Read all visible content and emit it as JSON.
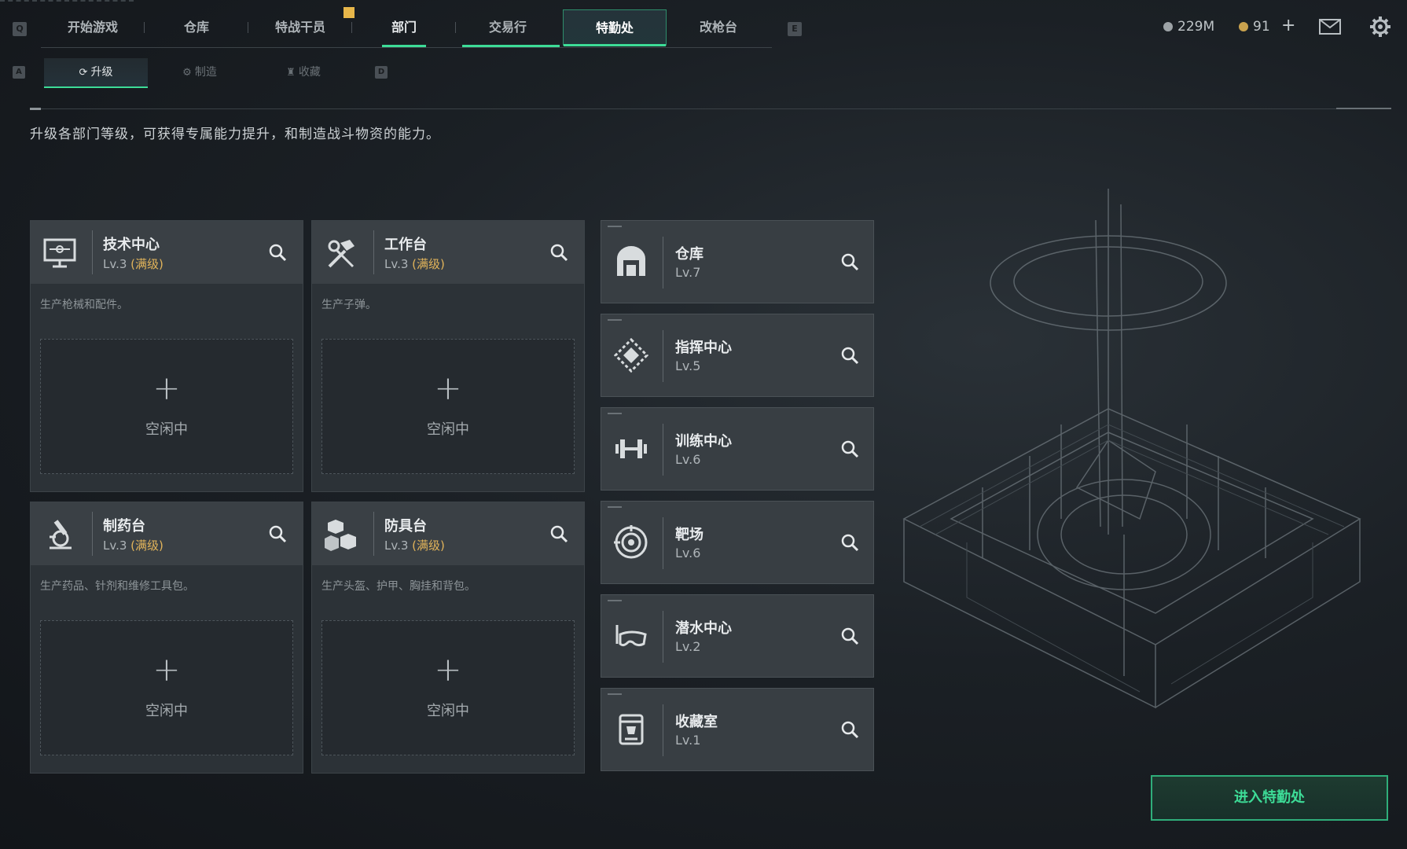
{
  "nav": {
    "key_left": "Q",
    "key_right": "E",
    "tabs": [
      {
        "label": "开始游戏"
      },
      {
        "label": "仓库"
      },
      {
        "label": "特战干员"
      },
      {
        "label": "部门"
      },
      {
        "label": "交易行"
      },
      {
        "label": "特勤处"
      },
      {
        "label": "改枪台"
      }
    ]
  },
  "currency": {
    "primary": "229M",
    "secondary": "91",
    "add": "+"
  },
  "subnav": {
    "key_left": "A",
    "key_right": "D",
    "tabs": [
      {
        "label": "升级"
      },
      {
        "label": "制造"
      },
      {
        "label": "收藏"
      }
    ]
  },
  "description": "升级各部门等级，可获得专属能力提升，和制造战斗物资的能力。",
  "big_cards": [
    {
      "name": "技术中心",
      "level": "Lv.3",
      "max": "(满级)",
      "desc": "生产枪械和配件。",
      "slot_plus": "+",
      "slot_status": "空闲中",
      "icon": "monitor-icon"
    },
    {
      "name": "工作台",
      "level": "Lv.3",
      "max": "(满级)",
      "desc": "生产子弹。",
      "slot_plus": "+",
      "slot_status": "空闲中",
      "icon": "tools-icon"
    },
    {
      "name": "制药台",
      "level": "Lv.3",
      "max": "(满级)",
      "desc": "生产药品、针剂和维修工具包。",
      "slot_plus": "+",
      "slot_status": "空闲中",
      "icon": "microscope-icon"
    },
    {
      "name": "防具台",
      "level": "Lv.3",
      "max": "(满级)",
      "desc": "生产头盔、护甲、胸挂和背包。",
      "slot_plus": "+",
      "slot_status": "空闲中",
      "icon": "cubes-icon"
    }
  ],
  "small_cards": [
    {
      "name": "仓库",
      "level": "Lv.7",
      "icon": "warehouse-icon"
    },
    {
      "name": "指挥中心",
      "level": "Lv.5",
      "icon": "command-icon"
    },
    {
      "name": "训练中心",
      "level": "Lv.6",
      "icon": "dumbbell-icon"
    },
    {
      "name": "靶场",
      "level": "Lv.6",
      "icon": "target-icon"
    },
    {
      "name": "潜水中心",
      "level": "Lv.2",
      "icon": "diving-mask-icon"
    },
    {
      "name": "收藏室",
      "level": "Lv.1",
      "icon": "trophy-case-icon"
    }
  ],
  "enter_button": "进入特勤处",
  "colors": {
    "accent": "#3ddc97",
    "max_level": "#e2b45a"
  }
}
